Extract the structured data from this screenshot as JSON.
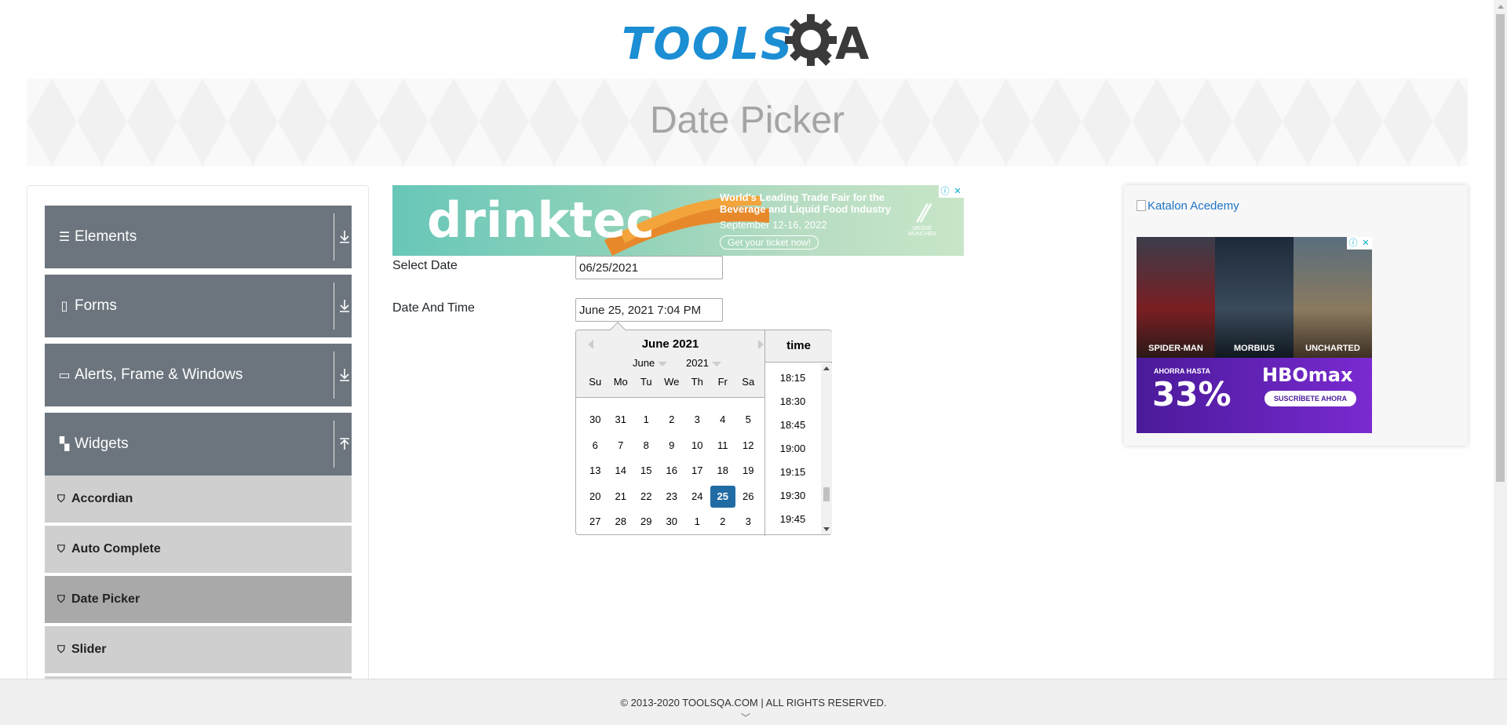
{
  "colors": {
    "logo_blue": "#1b8ed4",
    "sidebar_group": "#6c757d",
    "sidebar_item": "#cfcfcf",
    "sidebar_active": "#a9a9a9",
    "selected_day": "#216ba5"
  },
  "logo": {
    "text": "TOOLS",
    "suffix": "A"
  },
  "banner": {
    "title": "Date Picker"
  },
  "sidebar": {
    "groups": [
      {
        "label": "Elements",
        "icon": "hamburger-icon",
        "arrow": "download-icon"
      },
      {
        "label": "Forms",
        "icon": "document-icon",
        "arrow": "download-icon"
      },
      {
        "label": "Alerts, Frame & Windows",
        "icon": "window-icon",
        "arrow": "download-icon"
      },
      {
        "label": "Widgets",
        "icon": "widgets-icon",
        "arrow": "upload-icon"
      }
    ],
    "items": [
      {
        "label": "Accordian",
        "icon": "html5-icon"
      },
      {
        "label": "Auto Complete",
        "icon": "html5-icon"
      },
      {
        "label": "Date Picker",
        "icon": "html5-icon",
        "active": true
      },
      {
        "label": "Slider",
        "icon": "html5-icon"
      }
    ]
  },
  "ad_top": {
    "brand": "drinktec",
    "line1": "World's Leading Trade Fair for the",
    "line2": "Beverage and Liquid Food Industry",
    "line3": "September 12-16, 2022",
    "cta": "Get your ticket now!",
    "sponsor_line1": "MESSE",
    "sponsor_line2": "MÜNCHEN"
  },
  "form": {
    "select_date_label": "Select Date",
    "select_date_value": "06/25/2021",
    "date_time_label": "Date And Time",
    "date_time_value": "June 25, 2021 7:04 PM"
  },
  "datepicker": {
    "current_month": "June 2021",
    "month_select": "June",
    "year_select": "2021",
    "day_names": [
      "Su",
      "Mo",
      "Tu",
      "We",
      "Th",
      "Fr",
      "Sa"
    ],
    "weeks": [
      [
        "30",
        "31",
        "1",
        "2",
        "3",
        "4",
        "5"
      ],
      [
        "6",
        "7",
        "8",
        "9",
        "10",
        "11",
        "12"
      ],
      [
        "13",
        "14",
        "15",
        "16",
        "17",
        "18",
        "19"
      ],
      [
        "20",
        "21",
        "22",
        "23",
        "24",
        "25",
        "26"
      ],
      [
        "27",
        "28",
        "29",
        "30",
        "1",
        "2",
        "3"
      ]
    ],
    "selected_day": "25",
    "time_header": "time",
    "times": [
      "18:15",
      "18:30",
      "18:45",
      "19:00",
      "19:15",
      "19:30",
      "19:45"
    ]
  },
  "ad_right": {
    "image_alt": "Katalon Acedemy",
    "poster_titles": [
      "SPIDER-MAN",
      "MORBIUS",
      "UNCHARTED"
    ],
    "promo_prefix": "AHORRA HASTA",
    "promo_percent": "33%",
    "brand": "HBOmax",
    "cta": "SUSCRÍBETE AHORA"
  },
  "footer": {
    "copyright": "© 2013-2020 TOOLSQA.COM | ALL RIGHTS RESERVED."
  }
}
